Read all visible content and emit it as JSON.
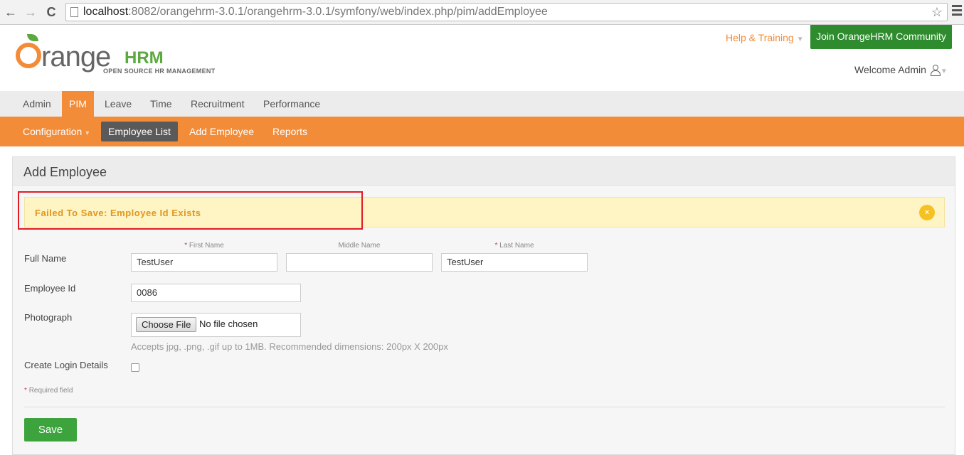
{
  "browser": {
    "back": "←",
    "forward": "→",
    "reload": "C",
    "url_host": "localhost",
    "url_rest": ":8082/orangehrm-3.0.1/orangehrm-3.0.1/symfony/web/index.php/pim/addEmployee",
    "star": "☆"
  },
  "header": {
    "logo_text": "range",
    "logo_hrm": "HRM",
    "logo_sub": "OPEN SOURCE HR MANAGEMENT",
    "help_link": "Help & Training",
    "join_button": "Join OrangeHRM Community",
    "welcome": "Welcome Admin",
    "caret": "▼"
  },
  "main_nav": {
    "items": [
      "Admin",
      "PIM",
      "Leave",
      "Time",
      "Recruitment",
      "Performance"
    ],
    "active": "PIM"
  },
  "sub_nav": {
    "items": [
      "Configuration",
      "Employee List",
      "Add Employee",
      "Reports"
    ],
    "active": "Employee List"
  },
  "panel": {
    "title": "Add Employee",
    "alert": "Failed To Save: Employee Id Exists",
    "alert_close": "×"
  },
  "form": {
    "full_name_label": "Full Name",
    "first_name_label": "First Name",
    "middle_name_label": "Middle Name",
    "last_name_label": "Last Name",
    "required_star": "*",
    "first_name_value": "TestUser",
    "middle_name_value": "",
    "last_name_value": "TestUser",
    "employee_id_label": "Employee Id",
    "employee_id_value": "0086",
    "photograph_label": "Photograph",
    "choose_file": "Choose File",
    "no_file": "No file chosen",
    "photo_hint": "Accepts jpg, .png, .gif up to 1MB. Recommended dimensions: 200px X 200px",
    "create_login_label": "Create Login Details",
    "create_login_checked": false,
    "required_note": "Required field",
    "save_button": "Save"
  },
  "colors": {
    "brand_orange": "#f28c38",
    "brand_green": "#5ca93f",
    "join_green": "#2e8b2e",
    "alert_text": "#e2961c",
    "highlight_red": "#e01b24"
  }
}
